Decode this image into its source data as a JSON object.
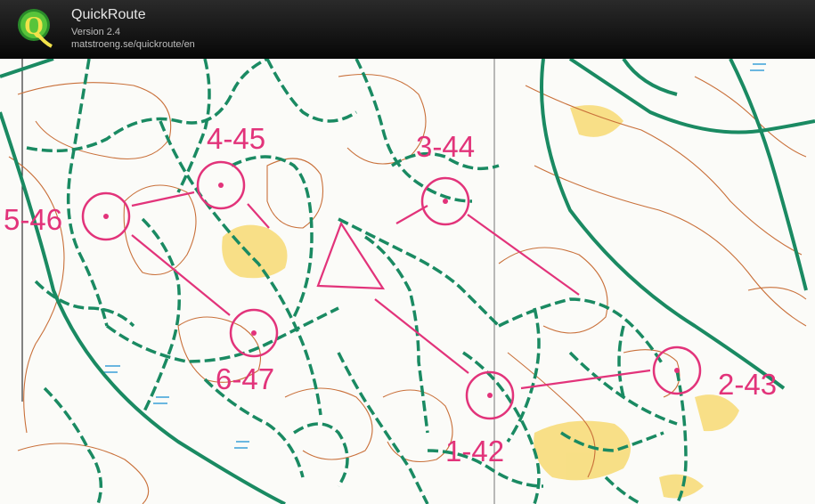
{
  "header": {
    "app_name": "QuickRoute",
    "version": "Version 2.4",
    "url": "matstroeng.se/quickroute/en",
    "logo_letter": "Q"
  },
  "map": {
    "controls": [
      {
        "id": "1-42",
        "label": "1-42"
      },
      {
        "id": "2-43",
        "label": "2-43"
      },
      {
        "id": "3-44",
        "label": "3-44"
      },
      {
        "id": "4-45",
        "label": "4-45"
      },
      {
        "id": "5-46",
        "label": "5-46"
      },
      {
        "id": "6-47",
        "label": "6-47"
      }
    ],
    "colors": {
      "course": "#e2337a",
      "path": "#1a8a62",
      "contour": "#c9703a",
      "open_land": "#f7dc7a",
      "marsh": "#3aa0d8"
    }
  }
}
